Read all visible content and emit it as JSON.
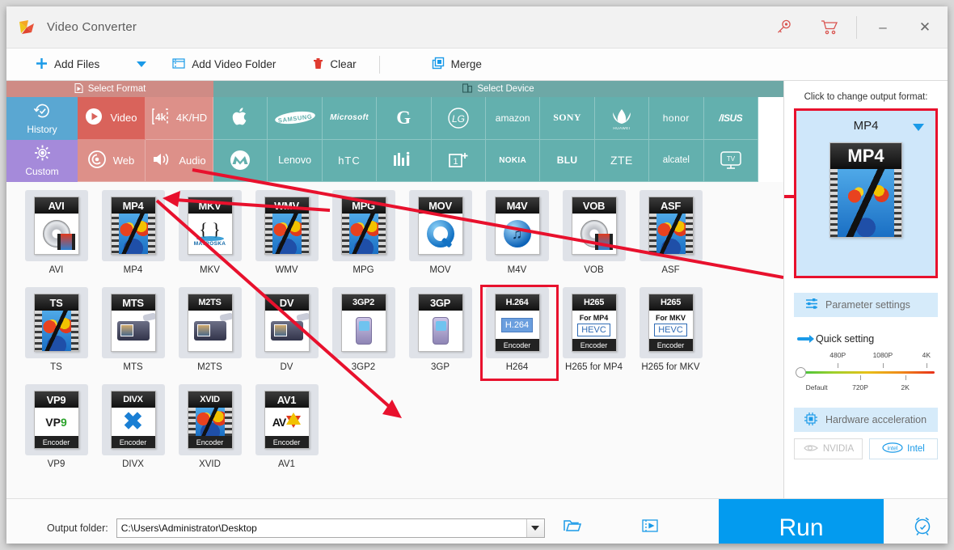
{
  "window": {
    "title": "Video Converter",
    "logo_icon": "app-logo-icon",
    "key_icon": "key-icon",
    "cart_icon": "cart-icon",
    "minimize_label": "–",
    "close_label": "✕"
  },
  "toolbar": {
    "add_files_label": "Add Files",
    "add_files_icon": "plus-icon",
    "dropdown_icon": "chevron-down-icon",
    "add_folder_label": "Add Video Folder",
    "add_folder_icon": "video-folder-icon",
    "clear_label": "Clear",
    "clear_icon": "trash-icon",
    "merge_label": "Merge",
    "merge_icon": "merge-icon"
  },
  "selector": {
    "format_header": "Select Format",
    "format_header_icon": "format-file-icon",
    "device_header": "Select Device",
    "device_header_icon": "device-icon",
    "side_tabs": [
      {
        "label": "History",
        "icon": "history-clock-icon",
        "color": "#5aa7d2"
      },
      {
        "label": "Custom",
        "icon": "gear-icon",
        "color": "#a58ada"
      }
    ],
    "format_tabs": [
      {
        "label": "Video",
        "icon": "play-circle-icon",
        "active": true
      },
      {
        "label": "4K/HD",
        "icon": "4k-icon",
        "active": false
      },
      {
        "label": "Web",
        "icon": "chrome-icon",
        "active": false
      },
      {
        "label": "Audio",
        "icon": "speaker-icon",
        "active": false
      }
    ],
    "device_brands_row1": [
      "Apple",
      "SAMSUNG",
      "Microsoft",
      "G",
      "LG",
      "amazon",
      "SONY",
      "HUAWEI",
      "honor",
      "ASUS"
    ],
    "device_brands_row2": [
      "Motorola",
      "Lenovo",
      "htc",
      "MI",
      "OnePlus",
      "NOKIA",
      "BLU",
      "ZTE",
      "alcatel",
      "TV"
    ]
  },
  "formats": [
    {
      "name": "AVI",
      "badge": "AVI",
      "art": "disc",
      "encoder": null
    },
    {
      "name": "MP4",
      "badge": "MP4",
      "art": "balloon",
      "encoder": null
    },
    {
      "name": "MKV",
      "badge": "MKV",
      "art": "mkv",
      "encoder": null
    },
    {
      "name": "WMV",
      "badge": "WMV",
      "art": "balloon",
      "encoder": null
    },
    {
      "name": "MPG",
      "badge": "MPG",
      "art": "balloon",
      "encoder": null
    },
    {
      "name": "MOV",
      "badge": "MOV",
      "art": "qt",
      "encoder": null
    },
    {
      "name": "M4V",
      "badge": "M4V",
      "art": "m4v",
      "encoder": null
    },
    {
      "name": "VOB",
      "badge": "VOB",
      "art": "disc",
      "encoder": null
    },
    {
      "name": "ASF",
      "badge": "ASF",
      "art": "balloon",
      "encoder": null
    },
    {
      "name": "TS",
      "badge": "TS",
      "art": "balloon",
      "encoder": null
    },
    {
      "name": "MTS",
      "badge": "MTS",
      "art": "cam",
      "encoder": null
    },
    {
      "name": "M2TS",
      "badge": "M2TS",
      "art": "cam",
      "encoder": null
    },
    {
      "name": "DV",
      "badge": "DV",
      "art": "cam",
      "encoder": null
    },
    {
      "name": "3GP2",
      "badge": "3GP2",
      "art": "phone",
      "encoder": null
    },
    {
      "name": "3GP",
      "badge": "3GP",
      "art": "phone",
      "encoder": null
    },
    {
      "name": "H264",
      "badge": "H.264",
      "art": "h264",
      "encoder": "Encoder",
      "selected": true
    },
    {
      "name": "H265 for MP4",
      "badge": "H265",
      "sub": "For MP4",
      "art": "hevc",
      "encoder": "Encoder"
    },
    {
      "name": "H265 for MKV",
      "badge": "H265",
      "sub": "For MKV",
      "art": "hevc",
      "encoder": "Encoder"
    },
    {
      "name": "VP9",
      "badge": "VP9",
      "art": "vp9",
      "encoder": "Encoder"
    },
    {
      "name": "DIVX",
      "badge": "DIVX",
      "art": "divx",
      "encoder": "Encoder"
    },
    {
      "name": "XVID",
      "badge": "XVID",
      "art": "balloon",
      "encoder": "Encoder"
    },
    {
      "name": "AV1",
      "badge": "AV1",
      "art": "av1",
      "encoder": "Encoder"
    }
  ],
  "right_panel": {
    "hint": "Click to change output format:",
    "output_format": "MP4",
    "dropdown_icon": "chevron-down-icon",
    "parameter_settings_label": "Parameter settings",
    "parameter_settings_icon": "sliders-icon",
    "quick_setting_label": "Quick setting",
    "quick_setting_icon": "arrow-right-icon",
    "slider_top_labels": [
      "480P",
      "1080P",
      "4K"
    ],
    "slider_bottom_labels": [
      "Default",
      "720P",
      "2K"
    ],
    "slider_value": "Default",
    "hardware_accel_label": "Hardware acceleration",
    "hardware_accel_icon": "cpu-chip-icon",
    "vendors": [
      {
        "label": "NVIDIA",
        "icon": "nvidia-icon",
        "enabled": false
      },
      {
        "label": "Intel",
        "icon": "intel-icon",
        "enabled": true
      }
    ]
  },
  "bottom": {
    "output_folder_label": "Output folder:",
    "output_folder_value": "C:\\Users\\Administrator\\Desktop",
    "dropdown_icon": "chevron-down-icon",
    "open_folder_icon": "folder-icon",
    "preview_icon": "video-preview-icon",
    "run_label": "Run",
    "alarm_icon": "alarm-clock-icon"
  },
  "annotations": {
    "accent_color": "#e8112d",
    "arrow_to_video_tab": "arrow-pointing-to-video-tab",
    "arrow_to_h264": "arrow-pointing-to-h264-tile",
    "arrow_to_output": "arrow-pointing-to-output-format-box"
  }
}
